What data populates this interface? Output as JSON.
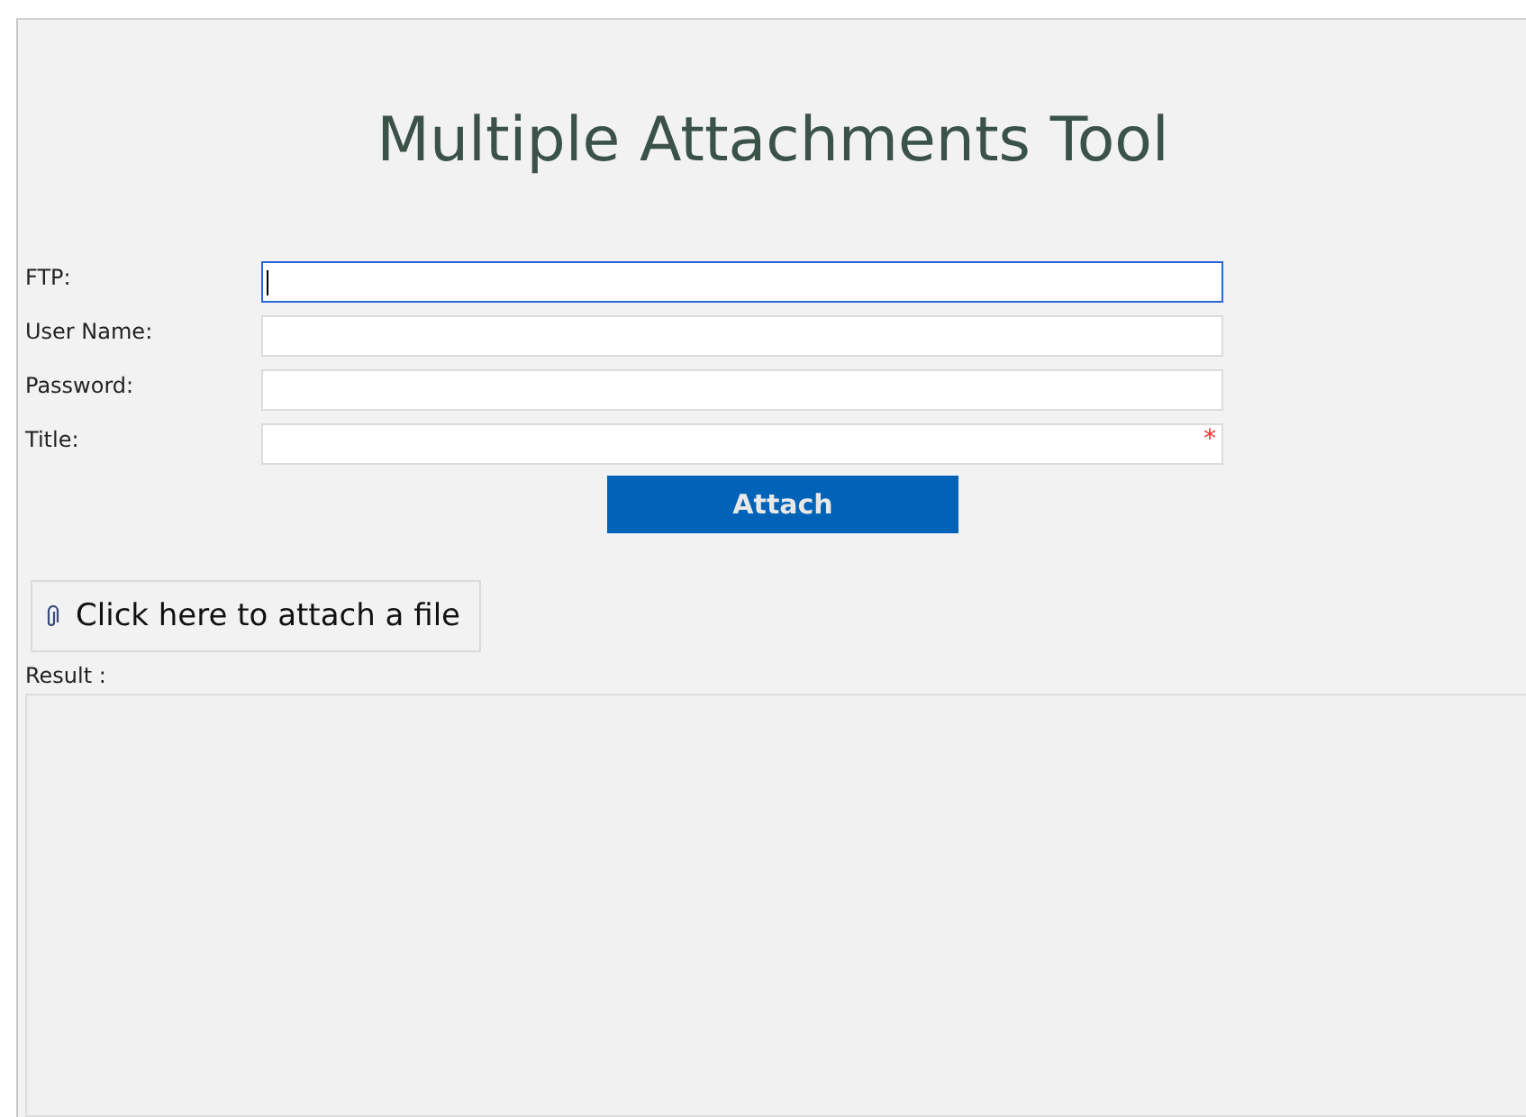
{
  "title": "Multiple Attachments Tool",
  "fields": [
    {
      "label": "FTP:",
      "focused": true,
      "required": false
    },
    {
      "label": "User Name:",
      "focused": false,
      "required": false
    },
    {
      "label": "Password:",
      "focused": false,
      "required": false
    },
    {
      "label": "Title:",
      "focused": false,
      "required": true
    }
  ],
  "required_mark": "*",
  "attach_button": "Attach",
  "attach_file_button": "Click here to attach a file",
  "result": {
    "label": "Result :"
  }
}
